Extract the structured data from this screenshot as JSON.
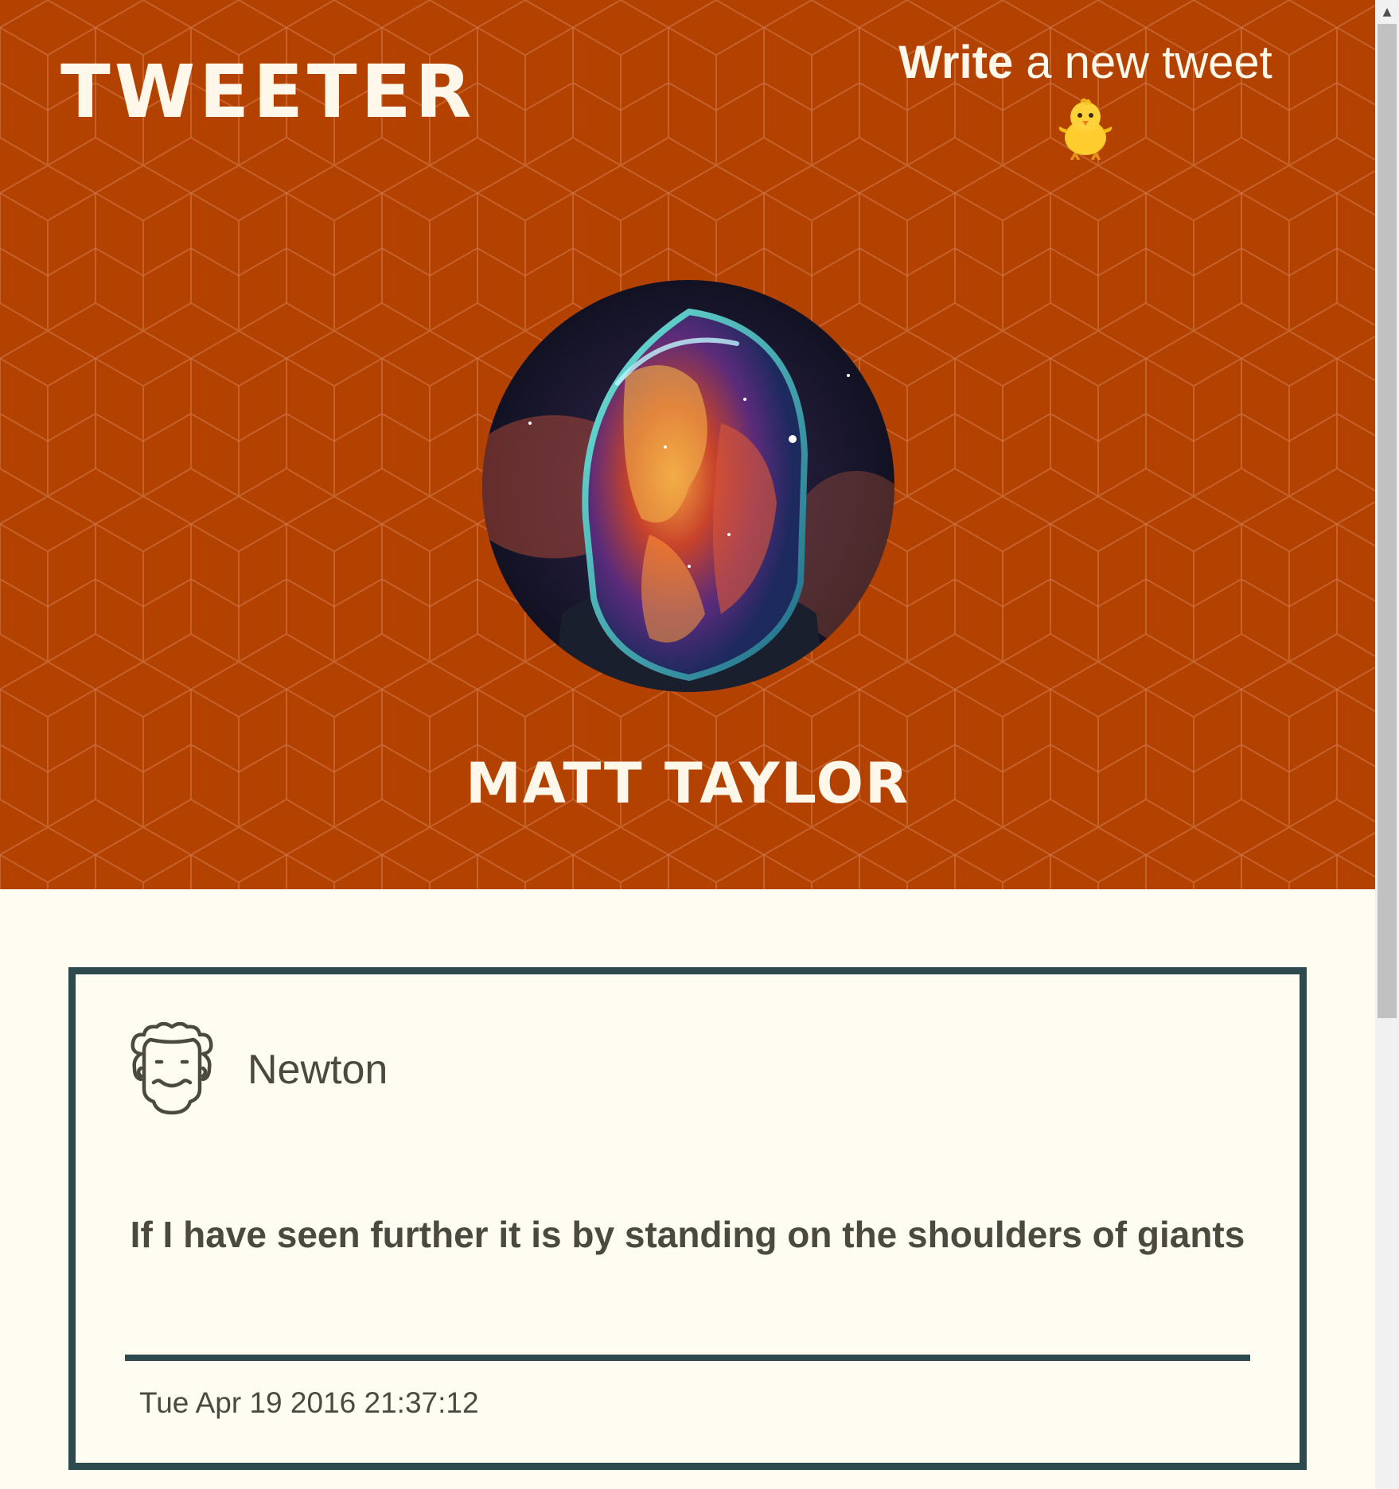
{
  "nav": {
    "brand": "TWEETER",
    "compose_strong": "Write",
    "compose_rest": " a new tweet",
    "compose_icon": "chick-icon"
  },
  "profile": {
    "name": "MATT TAYLOR",
    "avatar_icon": "cosmic-helmet-avatar"
  },
  "tweets": [
    {
      "author": "Newton",
      "avatar_icon": "newton-face-icon",
      "text": "If I have seen further it is by standing on the shoulders of giants",
      "date": "Tue Apr 19 2016 21:37:12"
    }
  ],
  "colors": {
    "header_bg": "#b34200",
    "page_bg": "#fffdf1",
    "accent": "#2d4b4e",
    "text": "#4a4a3f",
    "header_text": "#fff8ea"
  }
}
